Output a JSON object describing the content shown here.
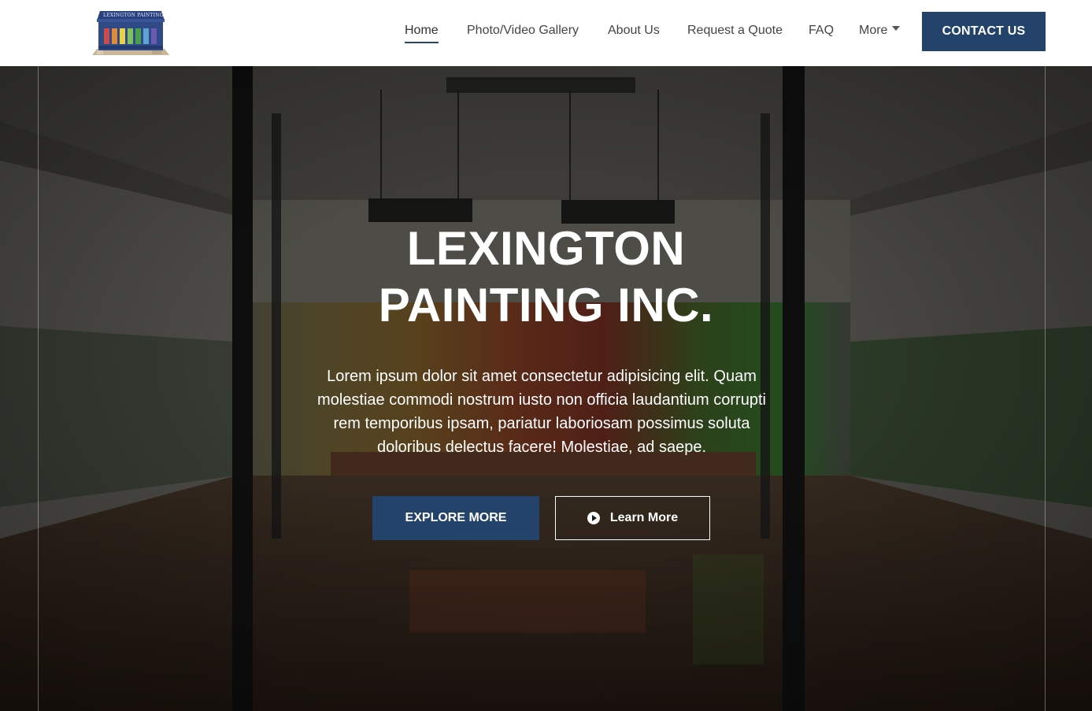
{
  "brand": {
    "logo_text": "LEXINGTON PAINTING",
    "accent_color": "#24436a"
  },
  "nav": {
    "items": [
      {
        "label": "Home",
        "active": true
      },
      {
        "label": "Photo/Video Gallery",
        "active": false
      },
      {
        "label": "About Us",
        "active": false
      },
      {
        "label": "Request a Quote",
        "active": false
      },
      {
        "label": "FAQ",
        "active": false
      },
      {
        "label": "More",
        "active": false,
        "icon": "caret-down-icon"
      }
    ],
    "contact_label": "CONTACT US"
  },
  "hero": {
    "title_line1": "LEXINGTON",
    "title_line2": "PAINTING INC.",
    "description": "Lorem ipsum dolor sit amet consectetur adipisicing elit. Quam molestiae commodi nostrum iusto non officia laudantium corrupti rem temporibus ipsam, pariatur laboriosam possimus soluta doloribus delectus facere! Molestiae, ad saepe.",
    "explore_label": "EXPLORE MORE",
    "learn_label": "Learn More",
    "learn_icon": "play-circle-icon"
  }
}
